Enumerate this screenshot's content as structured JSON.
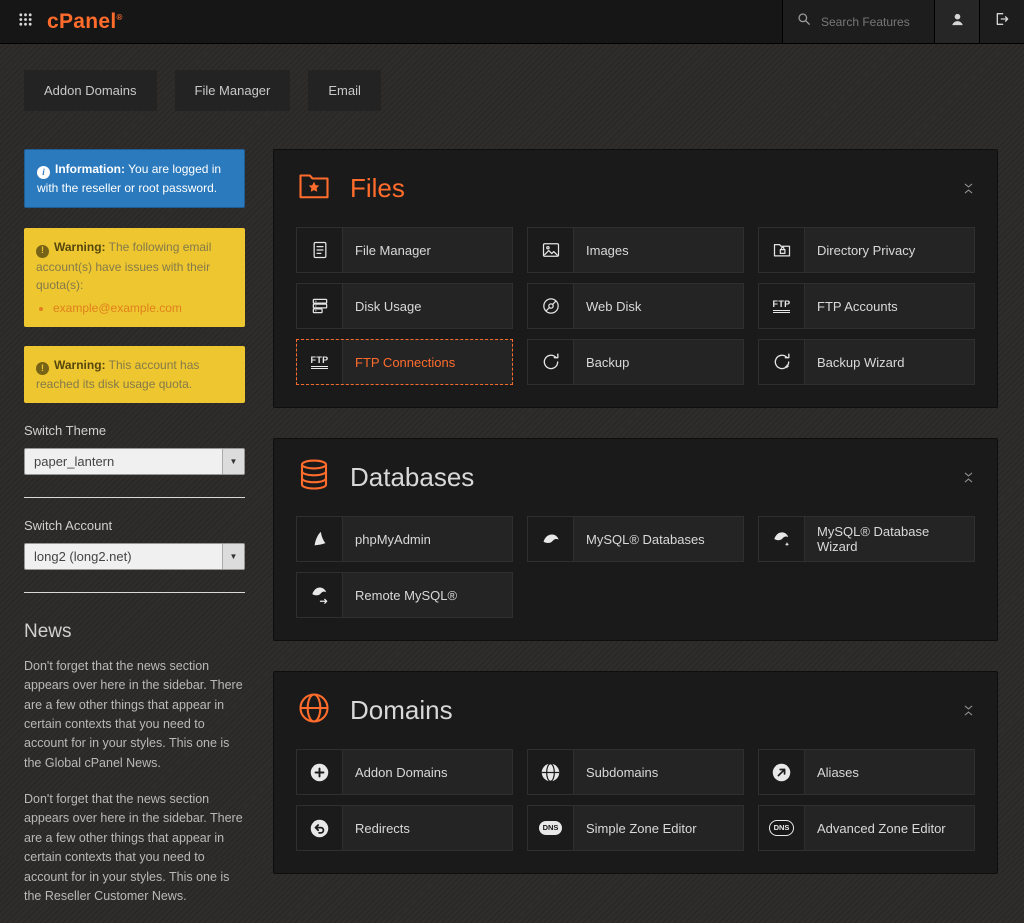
{
  "header": {
    "logo_text": "cPanel",
    "logo_tm": "®",
    "search_placeholder": "Search Features"
  },
  "icons": {
    "info_glyph": "i",
    "warning_glyph": "!",
    "dropdown_glyph": "▼",
    "ftp_glyph": "FTP",
    "dns_glyph": "DNS"
  },
  "colors": {
    "accent": "#ff6c2c",
    "info_blue": "#2b7abd",
    "warning_yellow": "#eec62f"
  },
  "quick_links": [
    "Addon Domains",
    "File Manager",
    "Email"
  ],
  "sidebar": {
    "info_box": {
      "label": "Information:",
      "text": "You are logged in with the reseller or root password."
    },
    "warning_quota": {
      "label": "Warning:",
      "text": "The following email account(s) have issues with their quota(s):",
      "links": [
        "example@example.com"
      ]
    },
    "warning_disk": {
      "label": "Warning:",
      "text": "This account has reached its disk usage quota."
    },
    "switch_theme": {
      "label": "Switch Theme",
      "value": "paper_lantern"
    },
    "switch_account": {
      "label": "Switch Account",
      "value": "long2 (long2.net)"
    },
    "news": {
      "title": "News",
      "paragraphs": [
        "Don't forget that the news section appears over here in the sidebar. There are a few other things that appear in certain contexts that you need to account for in your styles. This one is the Global cPanel News.",
        "Don't forget that the news section appears over here in the sidebar. There are a few other things that appear in certain contexts that you need to account for in your styles. This one is the Reseller Customer News."
      ]
    }
  },
  "sections": [
    {
      "title": "Files",
      "items": [
        {
          "label": "File Manager"
        },
        {
          "label": "Images"
        },
        {
          "label": "Directory Privacy"
        },
        {
          "label": "Disk Usage"
        },
        {
          "label": "Web Disk"
        },
        {
          "label": "FTP Accounts"
        },
        {
          "label": "FTP Connections",
          "highlighted": true
        },
        {
          "label": "Backup"
        },
        {
          "label": "Backup Wizard"
        }
      ]
    },
    {
      "title": "Databases",
      "items": [
        {
          "label": "phpMyAdmin"
        },
        {
          "label": "MySQL® Databases"
        },
        {
          "label": "MySQL® Database Wizard"
        },
        {
          "label": "Remote MySQL®"
        }
      ]
    },
    {
      "title": "Domains",
      "items": [
        {
          "label": "Addon Domains"
        },
        {
          "label": "Subdomains"
        },
        {
          "label": "Aliases"
        },
        {
          "label": "Redirects"
        },
        {
          "label": "Simple Zone Editor"
        },
        {
          "label": "Advanced Zone Editor"
        }
      ]
    }
  ]
}
